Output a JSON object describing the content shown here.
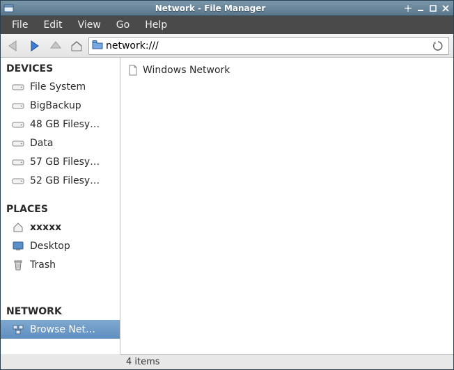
{
  "window": {
    "title": "Network - File Manager"
  },
  "menu": {
    "file": "File",
    "edit": "Edit",
    "view": "View",
    "go": "Go",
    "help": "Help"
  },
  "location": {
    "path": "network:///"
  },
  "sidebar": {
    "devices_header": "DEVICES",
    "devices": [
      {
        "label": "File System"
      },
      {
        "label": "BigBackup"
      },
      {
        "label": "48 GB Filesy…"
      },
      {
        "label": "Data"
      },
      {
        "label": "57 GB Filesy…"
      },
      {
        "label": "52 GB Filesy…"
      }
    ],
    "places_header": "PLACES",
    "places": [
      {
        "label": "xxxxx",
        "icon": "home"
      },
      {
        "label": "Desktop",
        "icon": "desktop"
      },
      {
        "label": "Trash",
        "icon": "trash"
      }
    ],
    "network_header": "NETWORK",
    "network": [
      {
        "label": "Browse Net…",
        "selected": true
      }
    ]
  },
  "content": {
    "items": [
      {
        "label": "Windows Network"
      }
    ]
  },
  "status": {
    "text": "4 items"
  }
}
